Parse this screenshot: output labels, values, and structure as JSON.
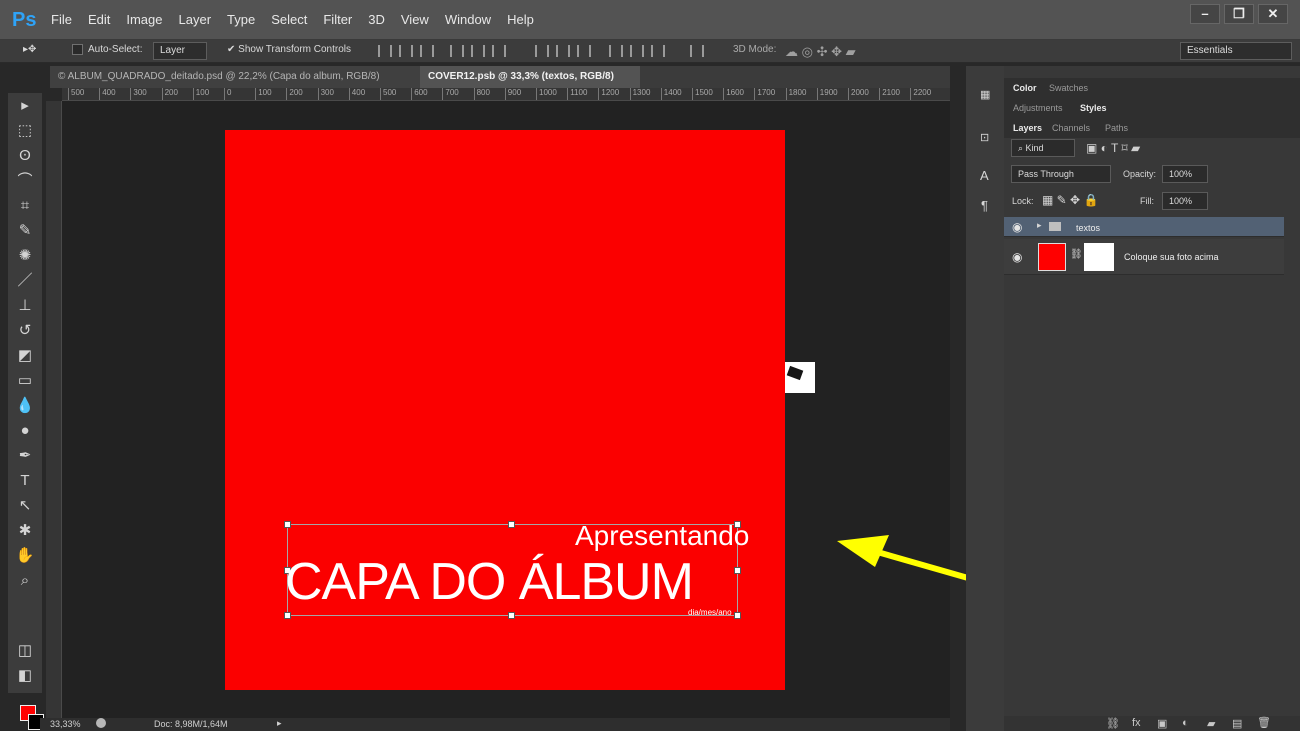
{
  "app": {
    "logo": "Ps",
    "menus": [
      "File",
      "Edit",
      "Image",
      "Layer",
      "Type",
      "Select",
      "Filter",
      "3D",
      "View",
      "Window",
      "Help"
    ],
    "window_controls": [
      "–",
      "❐",
      "✕"
    ]
  },
  "options": {
    "auto_select": "Auto-Select:",
    "layer_select": "Layer",
    "show_transform": "Show Transform Controls",
    "mode_3d": "3D Mode:",
    "workspace": "Essentials"
  },
  "tabs": [
    "© ALBUM_QUADRADO_deitado.psd @ 22,2% (Capa do album, RGB/8)",
    "COVER12.psb @ 33,3% (textos, RGB/8)"
  ],
  "ruler_ticks": [
    "500",
    "400",
    "300",
    "200",
    "100",
    "0",
    "100",
    "200",
    "300",
    "400",
    "500",
    "600",
    "700",
    "800",
    "900",
    "1000",
    "1100",
    "1200",
    "1300",
    "1400",
    "1500",
    "1600",
    "1700",
    "1800",
    "1900",
    "2000",
    "2100",
    "2200"
  ],
  "canvas": {
    "presenting": "Apresentando",
    "title": "CAPA DO ÁLBUM",
    "date": "dia/mes/ano",
    "accent": "#fb0000",
    "arrow_color": "#ffff00"
  },
  "status": {
    "zoom": "33,33%",
    "doc_size": "Doc: 8,98M/1,64M"
  },
  "panels": {
    "color_tabs": [
      "Color",
      "Swatches"
    ],
    "style_tabs": [
      "Adjustments",
      "Styles"
    ],
    "layer_tabs": [
      "Layers",
      "Channels",
      "Paths"
    ],
    "kind": "Kind",
    "blend_mode": "Pass Through",
    "opacity_label": "Opacity:",
    "opacity": "100%",
    "lock_label": "Lock:",
    "fill_label": "Fill:",
    "fill": "100%",
    "layers": [
      "textos",
      "Coloque sua foto acima"
    ]
  },
  "icons": {
    "eye": "◉",
    "folder": "▰",
    "chain": "⛓",
    "bottom": [
      "⛓",
      "fx",
      "▣",
      "◐",
      "▰",
      "▤",
      "🗑"
    ]
  }
}
